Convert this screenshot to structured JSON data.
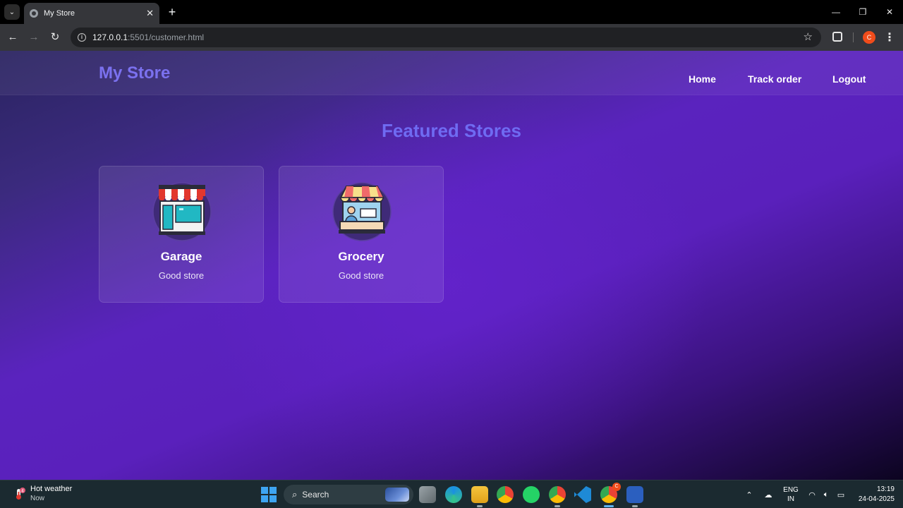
{
  "browser": {
    "tab_title": "My Store",
    "url_host": "127.0.0.1",
    "url_path": ":5501/customer.html",
    "profile_initial": "C"
  },
  "site": {
    "brand": "My Store",
    "nav": [
      "Home",
      "Track order",
      "Logout"
    ],
    "heading": "Featured Stores",
    "stores": [
      {
        "name": "Garage",
        "description": "Good store",
        "icon": "storefront-icon"
      },
      {
        "name": "Grocery",
        "description": "Good store",
        "icon": "shop-counter-icon"
      }
    ]
  },
  "taskbar": {
    "weather_title": "Hot weather",
    "weather_sub": "Now",
    "weather_badge": "4",
    "search_label": "Search",
    "lang_line1": "ENG",
    "lang_line2": "IN",
    "time": "13:19",
    "date": "24-04-2025",
    "chrome_badge": "C"
  },
  "colors": {
    "brand": "#7b71ef",
    "heading": "#6f6bf2",
    "background_mid": "#5a23be"
  }
}
